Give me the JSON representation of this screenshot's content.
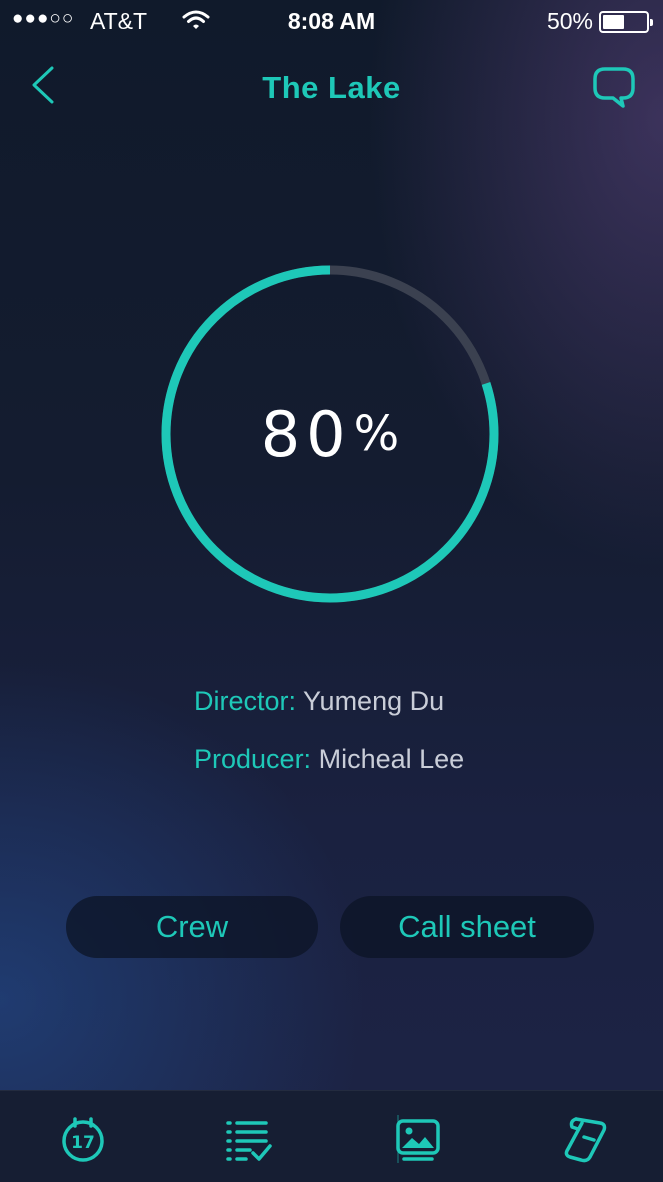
{
  "status_bar": {
    "signal": "●●●○○",
    "carrier": "AT&T",
    "time": "8:08 AM",
    "battery_percent": "50%",
    "battery_level": 0.5
  },
  "nav": {
    "title": "The Lake",
    "back_icon": "chevron-left-icon",
    "chat_icon": "chat-bubble-icon"
  },
  "progress": {
    "value_text": "80",
    "unit": "%",
    "fraction": 0.8
  },
  "credits": [
    {
      "key": "Director:",
      "value": "Yumeng Du"
    },
    {
      "key": "Producer:",
      "value": "Micheal Lee"
    }
  ],
  "actions": {
    "crew": "Crew",
    "call_sheet": "Call sheet"
  },
  "tabs": [
    {
      "icon": "calendar-icon",
      "label": "17"
    },
    {
      "icon": "checklist-icon"
    },
    {
      "icon": "image-icon"
    },
    {
      "icon": "script-scroll-icon"
    }
  ],
  "colors": {
    "accent": "#1ec8b8",
    "track": "#3b4150",
    "text_light": "#c9cdd8"
  }
}
